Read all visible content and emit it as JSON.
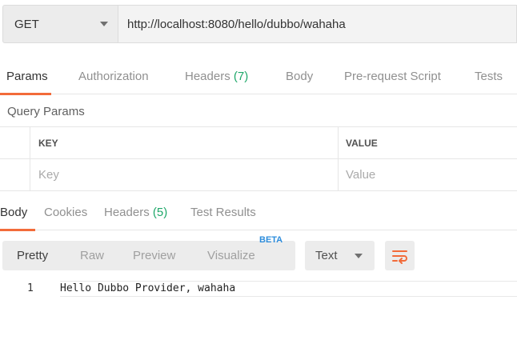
{
  "request": {
    "method": "GET",
    "url": "http://localhost:8080/hello/dubbo/wahaha"
  },
  "request_tabs": [
    {
      "label": "Params"
    },
    {
      "label": "Authorization"
    },
    {
      "label": "Headers ",
      "count": "(7)"
    },
    {
      "label": "Body"
    },
    {
      "label": "Pre-request Script"
    },
    {
      "label": "Tests"
    }
  ],
  "query_params": {
    "title": "Query Params",
    "columns": {
      "key": "KEY",
      "value": "VALUE"
    },
    "placeholders": {
      "key": "Key",
      "value": "Value"
    }
  },
  "response_tabs": [
    {
      "label": "Body"
    },
    {
      "label": "Cookies"
    },
    {
      "label": "Headers ",
      "count": "(5)"
    },
    {
      "label": "Test Results"
    }
  ],
  "response_toolbar": {
    "formats": [
      "Pretty",
      "Raw",
      "Preview",
      "Visualize"
    ],
    "beta": "BETA",
    "type": "Text"
  },
  "response_body": {
    "line_number": "1",
    "text": "Hello Dubbo Provider, wahaha"
  },
  "colors": {
    "accent": "#f26b3a",
    "count": "#1fa86a",
    "beta": "#2d8ddc"
  },
  "icons": {
    "method_dropdown": "chevron-down-icon",
    "type_dropdown": "chevron-down-icon",
    "wrap": "wrap-lines-icon"
  }
}
